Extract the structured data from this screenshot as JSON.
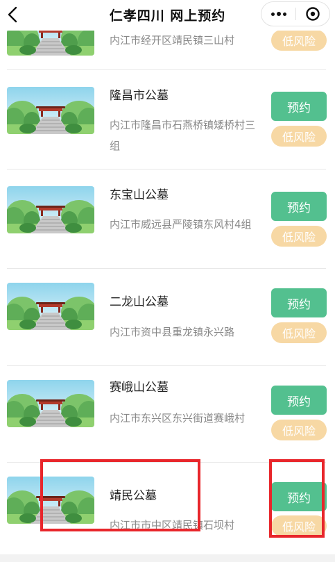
{
  "header": {
    "title": "仁孝四川 网上预约"
  },
  "colors": {
    "book_button": "#53c08f",
    "risk_badge": "#f7d8a4",
    "highlight": "#e8262b"
  },
  "items": [
    {
      "name": "",
      "address": "内江市经开区靖民镇三山村",
      "book_label": "",
      "risk_label": "低风险"
    },
    {
      "name": "隆昌市公墓",
      "address": "内江市隆昌市石燕桥镇矮桥村三组",
      "book_label": "预约",
      "risk_label": "低风险"
    },
    {
      "name": "东宝山公墓",
      "address": "内江市威远县严陵镇东风村4组",
      "book_label": "预约",
      "risk_label": "低风险"
    },
    {
      "name": "二龙山公墓",
      "address": "内江市资中县重龙镇永兴路",
      "book_label": "预约",
      "risk_label": "低风险"
    },
    {
      "name": "赛峨山公墓",
      "address": "内江市东兴区东兴街道赛峨村",
      "book_label": "预约",
      "risk_label": "低风险"
    },
    {
      "name": "靖民公墓",
      "address": "内江市市中区靖民镇石坝村",
      "book_label": "预约",
      "risk_label": "低风险"
    }
  ]
}
